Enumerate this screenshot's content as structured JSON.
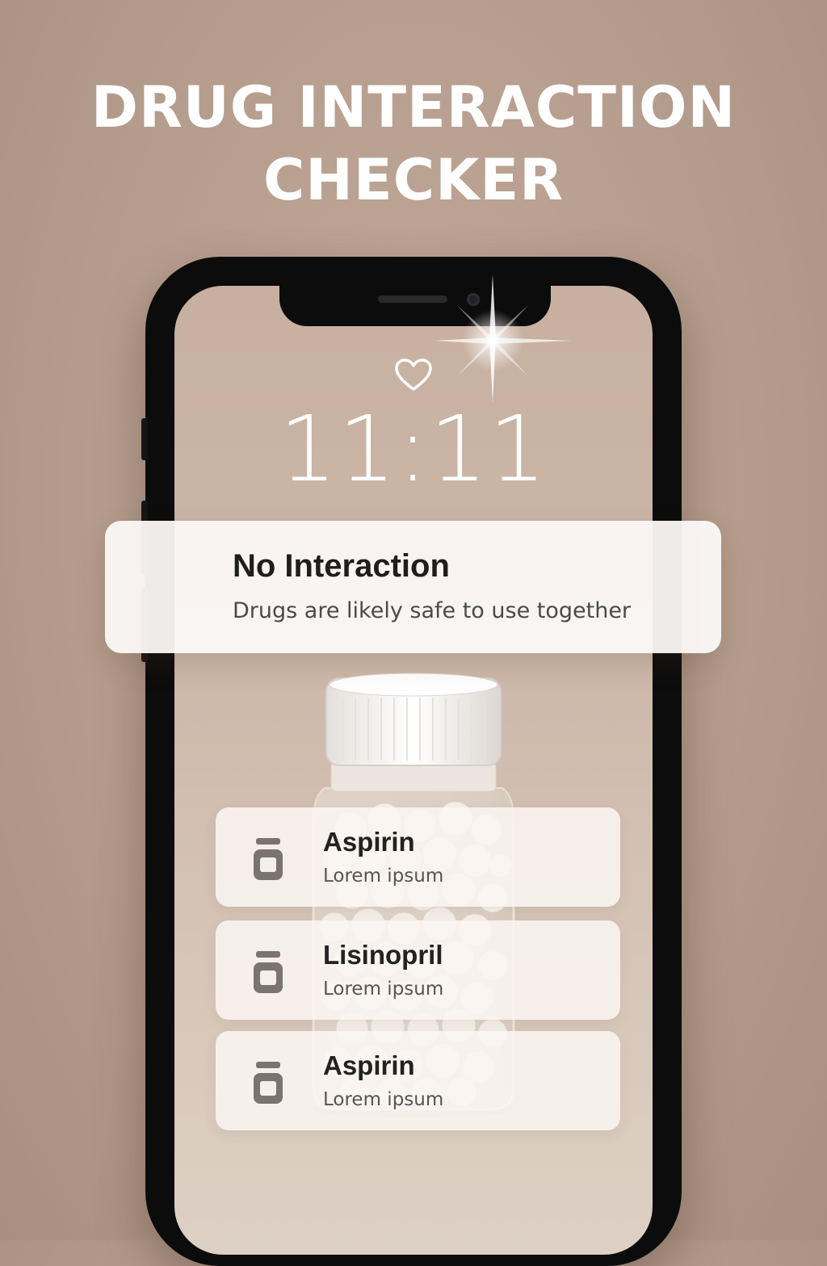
{
  "headline": {
    "line1": "DRUG INTERACTION",
    "line2": "CHECKER"
  },
  "lock_screen": {
    "status_icon": "heart-icon",
    "time": "11:11"
  },
  "notification": {
    "title": "No Interaction",
    "message": "Drugs are likely safe to use together"
  },
  "drug_list": [
    {
      "name": "Aspirin",
      "description": "Lorem ipsum",
      "icon": "pill-bottle-icon"
    },
    {
      "name": "Lisinopril",
      "description": "Lorem ipsum",
      "icon": "pill-bottle-icon"
    },
    {
      "name": "Aspirin",
      "description": "Lorem ipsum",
      "icon": "pill-bottle-icon"
    }
  ],
  "colors": {
    "background": "#b59d8d",
    "phone_frame": "#0c0c0c",
    "card": "#faf6f2",
    "text_dark": "#1e1e1e",
    "icon_gray": "#7a7470"
  }
}
